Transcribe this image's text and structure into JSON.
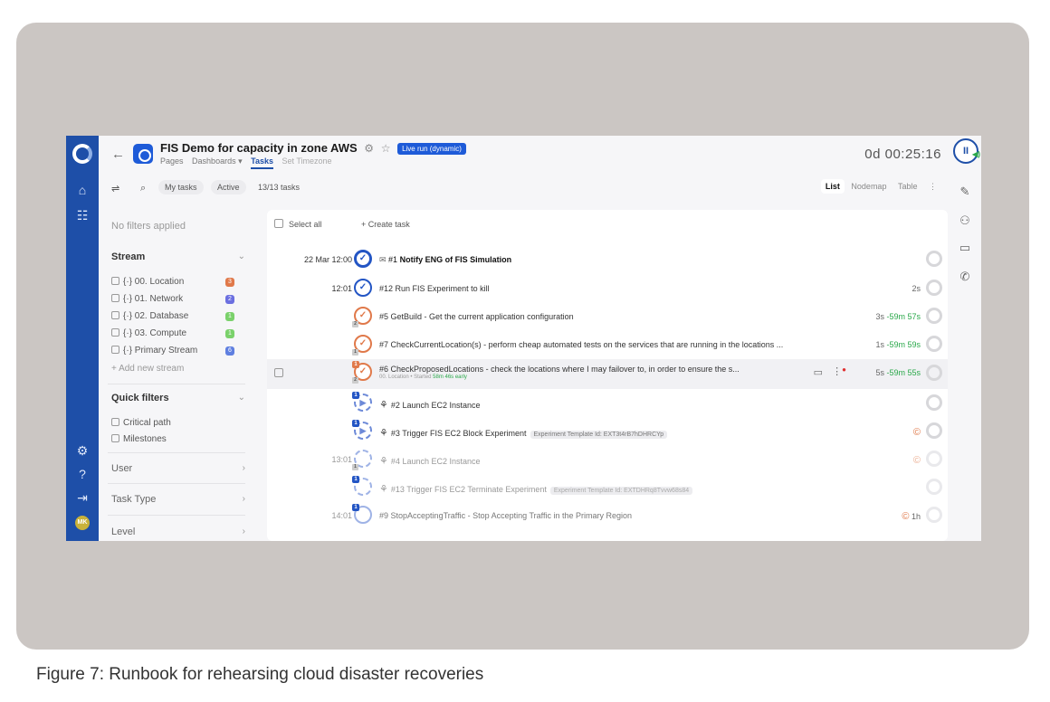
{
  "caption": "Figure 7: Runbook for rehearsing cloud disaster recoveries",
  "header": {
    "title": "FIS Demo for capacity in zone AWS",
    "live_badge": "Live run (dynamic)",
    "subnav": [
      "Pages",
      "Dashboards ▾",
      "Tasks",
      "Set Timezone"
    ],
    "timer": "0d 00:25:16"
  },
  "toolbar": {
    "my_tasks": "My tasks",
    "active": "Active",
    "count": "13/13 tasks",
    "views": [
      "List",
      "Nodemap",
      "Table"
    ]
  },
  "filters": {
    "no_filters": "No filters applied",
    "stream_heading": "Stream",
    "streams": [
      {
        "label": "{·} 00. Location",
        "count": "3",
        "color": "#e0794a"
      },
      {
        "label": "{·} 01. Network",
        "count": "2",
        "color": "#6b6fe0"
      },
      {
        "label": "{·} 02. Database",
        "count": "1",
        "color": "#7ad16b"
      },
      {
        "label": "{·} 03. Compute",
        "count": "1",
        "color": "#7ad16b"
      },
      {
        "label": "{·} Primary Stream",
        "count": "6",
        "color": "#5f7fe0"
      }
    ],
    "add_stream": "+ Add new stream",
    "quick_filters": "Quick filters",
    "quick_items": [
      "Critical path",
      "Milestones"
    ],
    "sections": [
      "User",
      "Task Type",
      "Level"
    ]
  },
  "tasklist": {
    "select_all": "Select all",
    "create_task": "+ Create task",
    "rows": [
      {
        "time": "22 Mar 12:00",
        "id": "#1",
        "title": "Notify ENG of FIS Simulation",
        "dur": "",
        "neg": ""
      },
      {
        "time": "12:01",
        "id": "#12",
        "title": "Run FIS Experiment to kill",
        "dur": "2s",
        "neg": ""
      },
      {
        "time": "",
        "id": "#5",
        "title": "GetBuild - Get the current application configuration",
        "dur": "3s",
        "neg": "-59m 57s"
      },
      {
        "time": "",
        "id": "#7",
        "title": "CheckCurrentLocation(s) - perform cheap automated tests on the services that are running in the locations ...",
        "dur": "1s",
        "neg": "-59m 59s"
      },
      {
        "time": "",
        "id": "#6",
        "title": "CheckProposedLocations - check the locations where I may failover to, in order to ensure the s...",
        "sub": "00. Location • Started",
        "sub_early": "58m 46s early",
        "dur": "5s",
        "neg": "-59m 55s"
      },
      {
        "time": "",
        "id": "#2",
        "title": "Launch EC2 Instance",
        "dur": "",
        "neg": ""
      },
      {
        "time": "",
        "id": "#3",
        "title": "Trigger FIS EC2 Block Experiment",
        "tag": "Experiment Template Id: EXT3t4rB7hDHRCYp",
        "dur": "",
        "neg": ""
      },
      {
        "time": "13:01",
        "id": "#4",
        "title": "Launch EC2 Instance",
        "dur": "",
        "neg": ""
      },
      {
        "time": "",
        "id": "#13",
        "title": "Trigger FIS EC2 Terminate Experiment",
        "tag": "Experiment Template Id: EXTDHRq8Tvvw68s84",
        "dur": "",
        "neg": ""
      },
      {
        "time": "14:01",
        "id": "#9",
        "title": "StopAcceptingTraffic - Stop Accepting Traffic in the Primary Region",
        "dur": "1h",
        "neg": ""
      }
    ]
  }
}
